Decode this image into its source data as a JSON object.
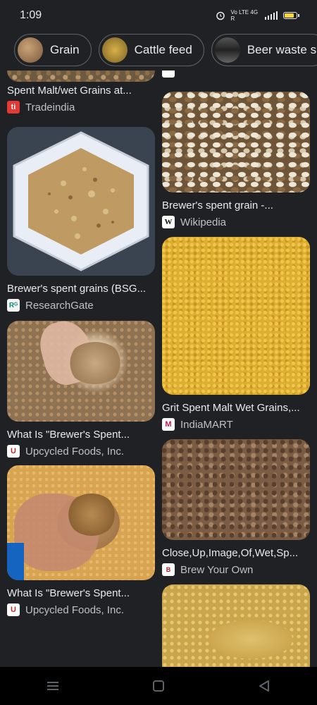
{
  "status": {
    "time": "1:09",
    "network_label": "Vo LTE 4G R"
  },
  "chips": [
    {
      "label": "Grain",
      "icon": "grain-thumbnail"
    },
    {
      "label": "Cattle feed",
      "icon": "cattle-feed-thumbnail"
    },
    {
      "label": "Beer waste s",
      "icon": "beer-waste-thumbnail"
    }
  ],
  "results": {
    "r0": {
      "caption": "Spent Malt/wet Grains at...",
      "source": "Tradeindia",
      "favicon": "ti"
    },
    "r1": {
      "caption": "Brewer's spent grains (BSG...",
      "source": "ResearchGate",
      "favicon": "Rᴳ"
    },
    "r2": {
      "caption": "What Is \"Brewer's Spent...",
      "source": "Upcycled Foods, Inc.",
      "favicon": "U"
    },
    "r3": {
      "caption": "What Is \"Brewer's Spent...",
      "source": "Upcycled Foods, Inc.",
      "favicon": "U"
    },
    "r4": {
      "caption": "Brewer's spent grain -...",
      "source": "Wikipedia",
      "favicon": "W"
    },
    "r5": {
      "caption": "Grit Spent Malt Wet Grains,...",
      "source": "IndiaMART",
      "favicon": "M"
    },
    "r6": {
      "caption": "Close,Up,Image,Of,Wet,Sp...",
      "source": "Brew Your Own",
      "favicon": "B"
    }
  },
  "colors": {
    "background": "#202124",
    "text": "#e8eaed",
    "battery": "#fdd835"
  }
}
